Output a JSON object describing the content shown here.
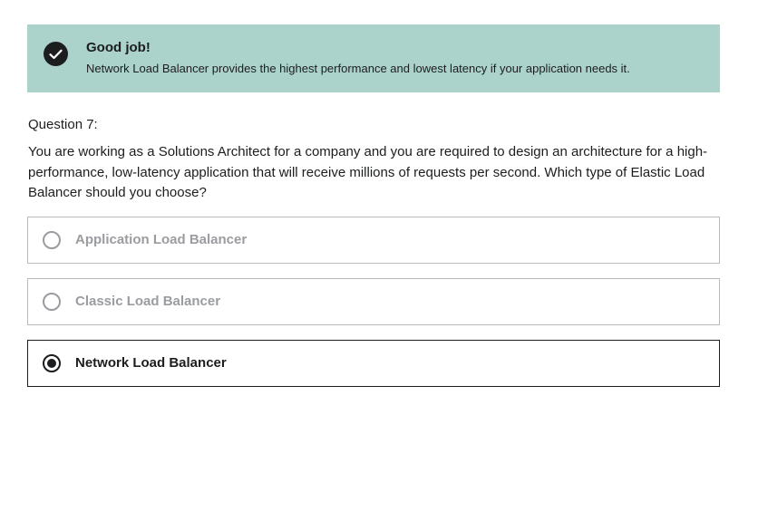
{
  "feedback": {
    "title": "Good job!",
    "message": "Network Load Balancer provides the highest performance and lowest latency if your application needs it.",
    "icon": "check-circle-icon",
    "background_color": "#acd2cc"
  },
  "question": {
    "label": "Question 7:",
    "text": "You are working as a Solutions Architect for a company and you are required to design an architecture for a high-performance, low-latency application that will receive millions of requests per second. Which type of Elastic Load Balancer should you choose?"
  },
  "options": [
    {
      "label": "Application Load Balancer",
      "selected": false
    },
    {
      "label": "Classic Load Balancer",
      "selected": false
    },
    {
      "label": "Network Load Balancer",
      "selected": true
    }
  ]
}
